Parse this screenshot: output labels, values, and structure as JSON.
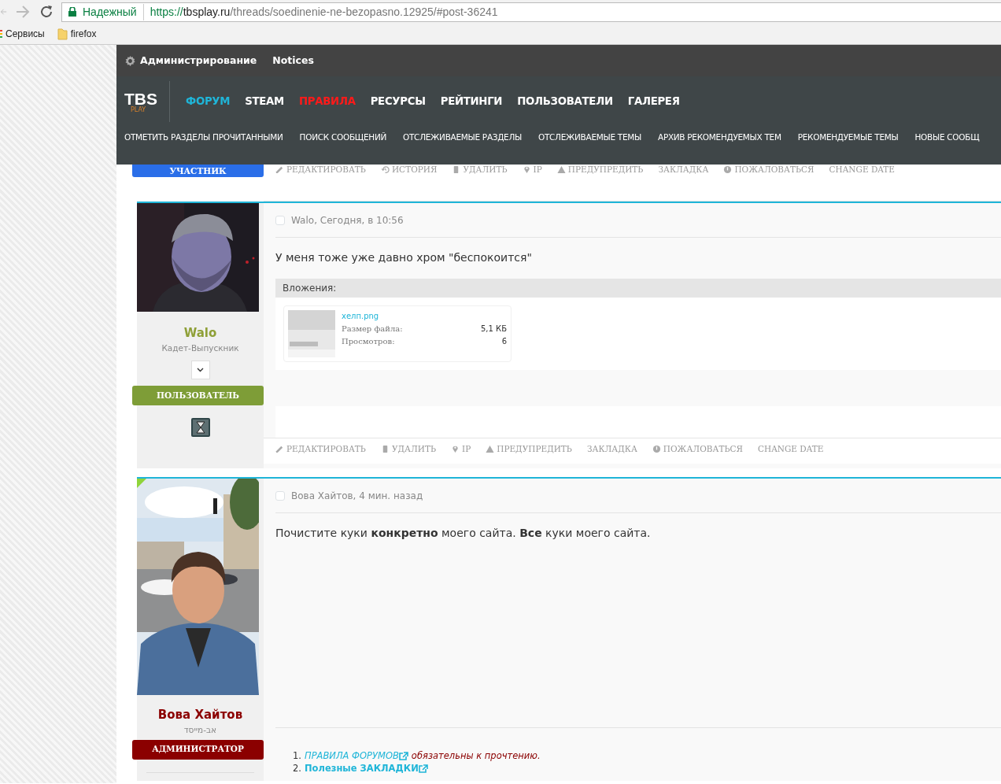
{
  "browser": {
    "security_label": "Надежный",
    "url_scheme": "https://",
    "url_host": "tbsplay.ru",
    "url_path": "/threads/soedinenie-ne-bezopasno.12925/#post-36241"
  },
  "bookmarks": [
    {
      "label": "Сервисы",
      "kind": "apps"
    },
    {
      "label": "firefox",
      "kind": "folder"
    }
  ],
  "admin_bar": [
    {
      "label": "Администрирование",
      "kind": "gear"
    },
    {
      "label": "Notices",
      "kind": "plain"
    }
  ],
  "logo": {
    "text": "TBS",
    "subtext": "PLAY"
  },
  "main_nav": [
    {
      "label": "ФОРУМ",
      "color": "#1fb5d8"
    },
    {
      "label": "STEAM",
      "color": "#ffffff"
    },
    {
      "label": "ПРАВИЛА",
      "color": "#ff1a1a"
    },
    {
      "label": "РЕСУРСЫ",
      "color": "#ffffff"
    },
    {
      "label": "РЕЙТИНГИ",
      "color": "#ffffff"
    },
    {
      "label": "ПОЛЬЗОВАТЕЛИ",
      "color": "#ffffff"
    },
    {
      "label": "ГАЛЕРЕЯ",
      "color": "#ffffff"
    }
  ],
  "sub_nav": [
    "ОТМЕТИТЬ РАЗДЕЛЫ ПРОЧИТАННЫМИ",
    "ПОИСК СООБЩЕНИЙ",
    "ОТСЛЕЖИВАЕМЫЕ РАЗДЕЛЫ",
    "ОТСЛЕЖИВАЕМЫЕ ТЕМЫ",
    "АРХИВ РЕКОМЕНДУЕМЫХ ТЕМ",
    "РЕКОМЕНДУЕМЫЕ ТЕМЫ",
    "НОВЫЕ СООБЩ"
  ],
  "posts": [
    {
      "kind": "tail",
      "role": {
        "label": "УЧАСТНИК",
        "color": "#2a6ee8"
      },
      "actions": [
        {
          "label": "РЕДАКТИРОВАТЬ",
          "kind": "pencil"
        },
        {
          "label": "ИСТОРИЯ",
          "kind": "history"
        },
        {
          "label": "УДАЛИТЬ",
          "kind": "trash"
        },
        {
          "label": "IP",
          "kind": "pin"
        },
        {
          "label": "ПРЕДУПРЕДИТЬ",
          "kind": "warning"
        },
        {
          "label": "ЗАКЛАДКА",
          "kind": "none"
        },
        {
          "label": "ПОЖАЛОВАТЬСЯ",
          "kind": "info"
        },
        {
          "label": "CHANGE DATE",
          "kind": "none"
        }
      ]
    },
    {
      "kind": "full",
      "new": false,
      "avatar": {
        "kind": "picture"
      },
      "author": {
        "name": "Walo",
        "color": "#8fa038",
        "rank": "Кадет-Выпускник"
      },
      "menu_toggle": true,
      "role": {
        "label": "ПОЛЬЗОВАТЕЛЬ",
        "color": "#7e9d37"
      },
      "badge": true,
      "checked": false,
      "byline": "Walo, Сегодня, в 10:56",
      "message": "У меня тоже уже давно хром \"беспокоится\"",
      "attachments": {
        "title": "Вложения:",
        "files": [
          {
            "name": "хелп.png",
            "size_label": "Размер файла:",
            "size": "5,1 КБ",
            "views_label": "Просмотров:",
            "views": "6"
          }
        ]
      },
      "empty_signature": true,
      "actions": [
        {
          "label": "РЕДАКТИРОВАТЬ",
          "kind": "pencil"
        },
        {
          "label": "УДАЛИТЬ",
          "kind": "trash"
        },
        {
          "label": "IP",
          "kind": "pin"
        },
        {
          "label": "ПРЕДУПРЕДИТЬ",
          "kind": "warning"
        },
        {
          "label": "ЗАКЛАДКА",
          "kind": "none"
        },
        {
          "label": "ПОЖАЛОВАТЬСЯ",
          "kind": "info"
        },
        {
          "label": "CHANGE DATE",
          "kind": "none"
        }
      ]
    },
    {
      "kind": "full",
      "new": true,
      "avatar": {
        "kind": "picture"
      },
      "author": {
        "name": "Вова Хайтов",
        "color": "#8b0000",
        "rank": "אב-מייסד"
      },
      "menu_toggle": false,
      "role": {
        "label": "АДМИНИСТРАТОР",
        "color": "#8b0000"
      },
      "badge": false,
      "checked": false,
      "byline": "Вова Хайтов, 4 мин. назад",
      "message": "Почистите куки **конкретно** моего сайта. **Все** куки моего сайта.",
      "empty_signature": false,
      "signature": [
        {
          "number": "1.",
          "link": "ПРАВИЛА ФОРУМОВ",
          "italic": true,
          "bold": false,
          "note": "обязательны к прочтению."
        },
        {
          "number": "2.",
          "link": "Полезные ЗАКЛАДКИ",
          "italic": false,
          "bold": true
        }
      ]
    }
  ]
}
